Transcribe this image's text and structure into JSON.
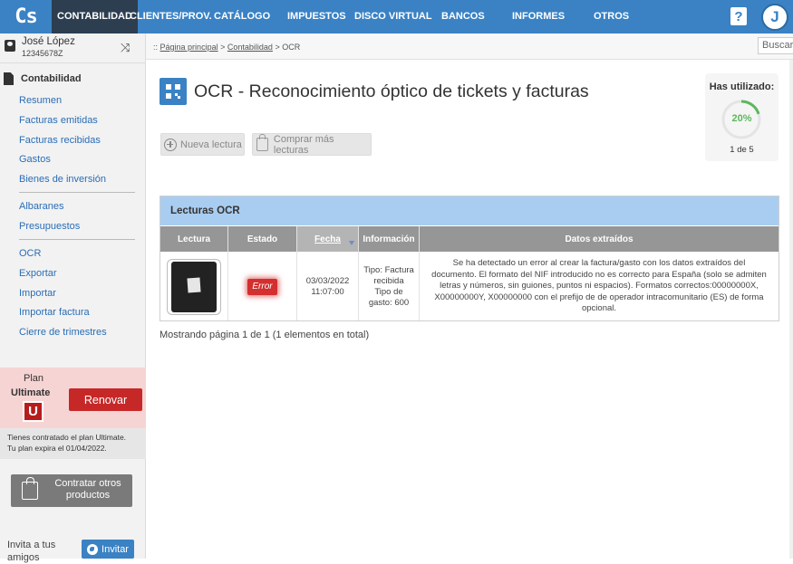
{
  "app": {
    "logo": "Cs"
  },
  "nav": {
    "items": [
      {
        "label": "CONTABILIDAD",
        "active": true
      },
      {
        "label": "CLIENTES/PROV."
      },
      {
        "label": "CATÁLOGO"
      },
      {
        "label": "IMPUESTOS"
      },
      {
        "label": "DISCO VIRTUAL"
      },
      {
        "label": "BANCOS"
      },
      {
        "label": "INFORMES"
      },
      {
        "label": "OTROS"
      }
    ],
    "help": "?",
    "avatar_initial": "J"
  },
  "user": {
    "name": "José López",
    "id": "12345678Z"
  },
  "sidebar": {
    "section": "Contabilidad",
    "groups": [
      [
        "Resumen",
        "Facturas emitidas",
        "Facturas recibidas",
        "Gastos",
        "Bienes de inversión"
      ],
      [
        "Albaranes",
        "Presupuestos"
      ],
      [
        "OCR",
        "Exportar",
        "Importar",
        "Importar factura",
        "Cierre de trimestres"
      ]
    ],
    "plan": {
      "label": "Plan",
      "name": "Ultimate",
      "badge": "U",
      "renew": "Renovar",
      "info_1": "Tienes contratado el plan Ultimate.",
      "info_2": "Tu plan expira el 01/04/2022."
    },
    "more_products": "Contratar otros productos",
    "invite_text": "Invita a tus amigos",
    "invite_button": "Invitar"
  },
  "breadcrumb": {
    "prefix": "::",
    "home": "Página principal",
    "sep": ">",
    "section": "Contabilidad",
    "current": "OCR"
  },
  "search": {
    "placeholder": "Buscar"
  },
  "page": {
    "title": "OCR - Reconocimiento óptico de tickets y facturas",
    "new_reading": "Nueva lectura",
    "buy_more": "Comprar más lecturas"
  },
  "usage": {
    "title": "Has utilizado:",
    "percent_label": "20%",
    "percent": 20,
    "count": "1 de 5",
    "color": "#5cb85c"
  },
  "table": {
    "panel_title": "Lecturas OCR",
    "headers": [
      "Lectura",
      "Estado",
      "Fecha",
      "Información",
      "Datos extraídos"
    ],
    "rows": [
      {
        "status": "Error",
        "date": "03/03/2022",
        "time": "11:07:00",
        "info_1": "Tipo: Factura",
        "info_2": "recibida",
        "info_3": "Tipo de",
        "info_4": "gasto: 600",
        "extracted": "Se ha detectado un error al crear la factura/gasto con los datos extraídos del documento. El formato del NIF introducido no es correcto para España (solo se admiten letras y números, sin guiones, puntos ni espacios). Formatos correctos:00000000X, X00000000Y, X00000000 con el prefijo de de operador intracomunitario (ES) de forma opcional."
      }
    ],
    "footer": "Mostrando página 1 de 1 (1 elementos en total)"
  }
}
